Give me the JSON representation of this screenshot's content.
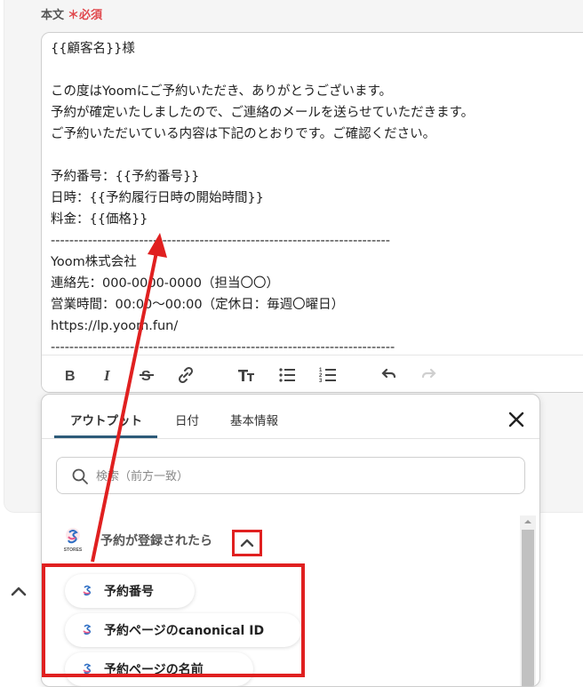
{
  "field": {
    "label": "本文",
    "required_mark": "＊",
    "required_text": "必須"
  },
  "editor": {
    "body": "{{顧客名}}様\n\nこの度はYoomにご予約いただき、ありがとうございます。\n予約が確定いたしましたので、ご連絡のメールを送らせていただきます。\nご予約いただいている内容は下記のとおりです。ご確認ください。\n\n予約番号：{{予約番号}}\n日時：{{予約履行日時の開始時間}}\n料金：{{価格}}\n-------------------------------------------------------------------------\nYoom株式会社\n連絡先：000-0000-0000（担当〇〇）\n営業時間：00:00〜00:00（定休日：毎週〇曜日）\nhttps://lp.yoom.fun/\n--------------------------------------------------------------------------",
    "toolbar": [
      "bold-icon",
      "italic-icon",
      "strikethrough-icon",
      "link-icon",
      "text-size-icon",
      "bullet-list-icon",
      "numbered-list-icon",
      "undo-icon",
      "redo-icon"
    ]
  },
  "popup": {
    "tabs": [
      {
        "label": "アウトプット",
        "active": true
      },
      {
        "label": "日付",
        "active": false
      },
      {
        "label": "基本情報",
        "active": false
      }
    ],
    "search_placeholder": "検索（前方一致）",
    "group": {
      "title": "予約が登録されたら",
      "logo_text": "STORES",
      "items": [
        {
          "label": "予約番号"
        },
        {
          "label": "予約ページのcanonical ID"
        },
        {
          "label": "予約ページの名前"
        }
      ]
    }
  },
  "colors": {
    "accent": "#2d5b79",
    "annotation_red": "#e02020",
    "required_red": "#e0474c"
  }
}
